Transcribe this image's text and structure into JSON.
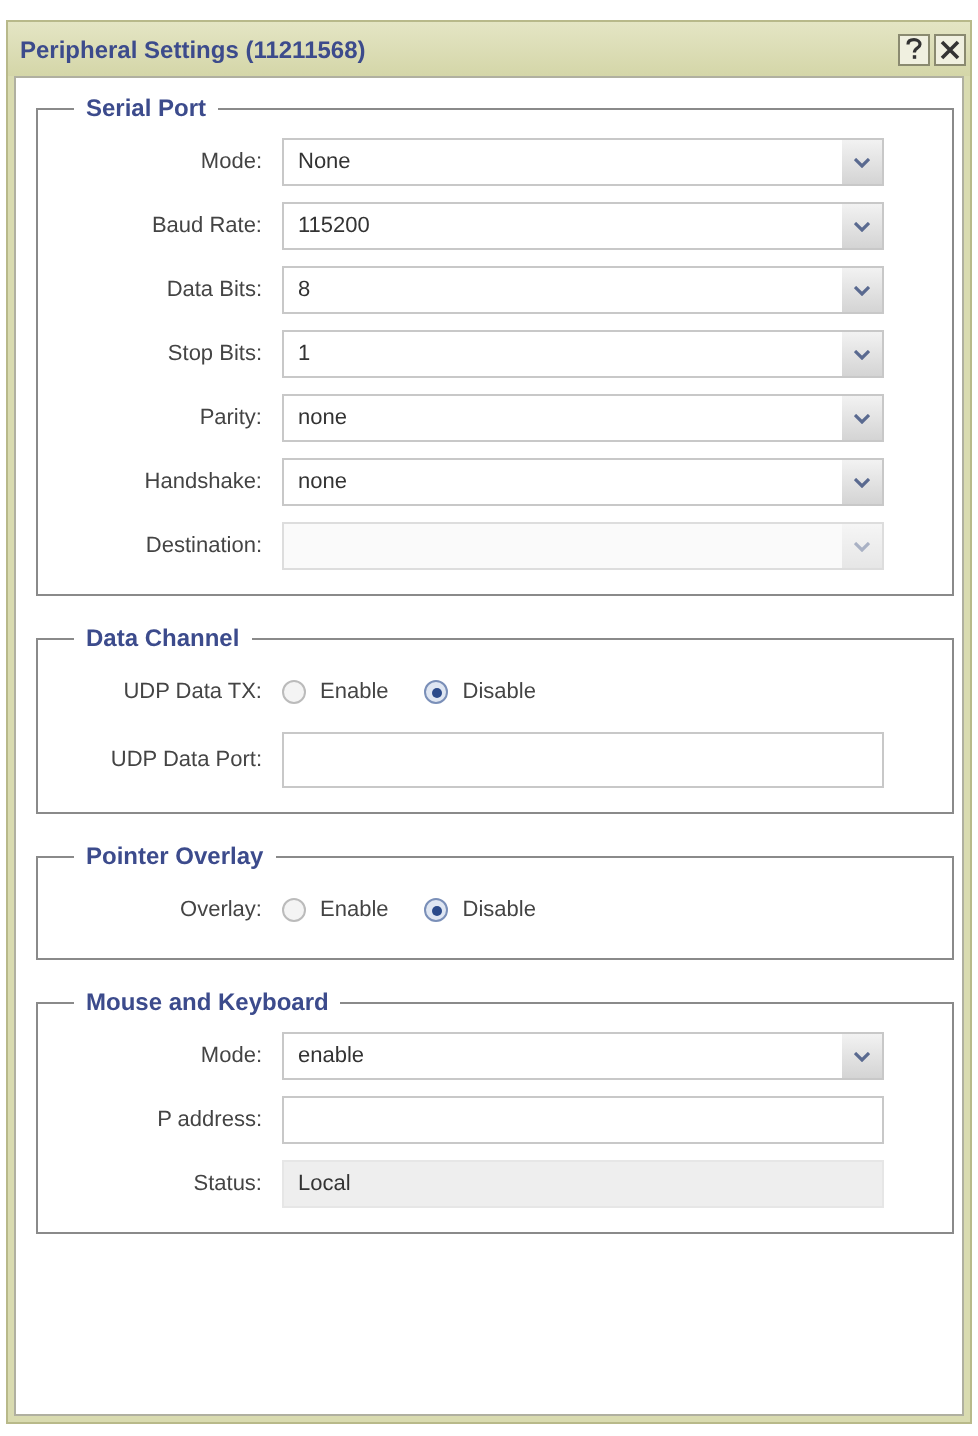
{
  "window": {
    "title": "Peripheral Settings (11211568)"
  },
  "sections": [
    {
      "title": "Serial Port",
      "rows": [
        {
          "kind": "select",
          "label": "Mode:",
          "value": "None",
          "disabled": false
        },
        {
          "kind": "select",
          "label": "Baud Rate:",
          "value": "115200",
          "disabled": false
        },
        {
          "kind": "select",
          "label": "Data Bits:",
          "value": "8",
          "disabled": false
        },
        {
          "kind": "select",
          "label": "Stop Bits:",
          "value": "1",
          "disabled": false
        },
        {
          "kind": "select",
          "label": "Parity:",
          "value": "none",
          "disabled": false
        },
        {
          "kind": "select",
          "label": "Handshake:",
          "value": "none",
          "disabled": false
        },
        {
          "kind": "select",
          "label": "Destination:",
          "disabled": true
        }
      ]
    },
    {
      "title": "Data Channel",
      "rows": [
        {
          "kind": "radio",
          "label": "UDP Data TX:",
          "options": [
            {
              "label": "Enable",
              "selected": false
            },
            {
              "label": "Disable",
              "selected": true
            }
          ]
        },
        {
          "kind": "text",
          "label": "UDP Data Port:"
        }
      ]
    },
    {
      "title": "Pointer Overlay",
      "rows": [
        {
          "kind": "radio",
          "label": "Overlay:",
          "options": [
            {
              "label": "Enable",
              "selected": false
            },
            {
              "label": "Disable",
              "selected": true
            }
          ]
        }
      ]
    },
    {
      "title": "Mouse and Keyboard",
      "rows": [
        {
          "kind": "select",
          "label": "Mode:",
          "value": "enable",
          "disabled": false
        },
        {
          "kind": "text",
          "label": "P address:"
        },
        {
          "kind": "readonly",
          "label": "Status:",
          "value": "Local"
        }
      ]
    }
  ]
}
